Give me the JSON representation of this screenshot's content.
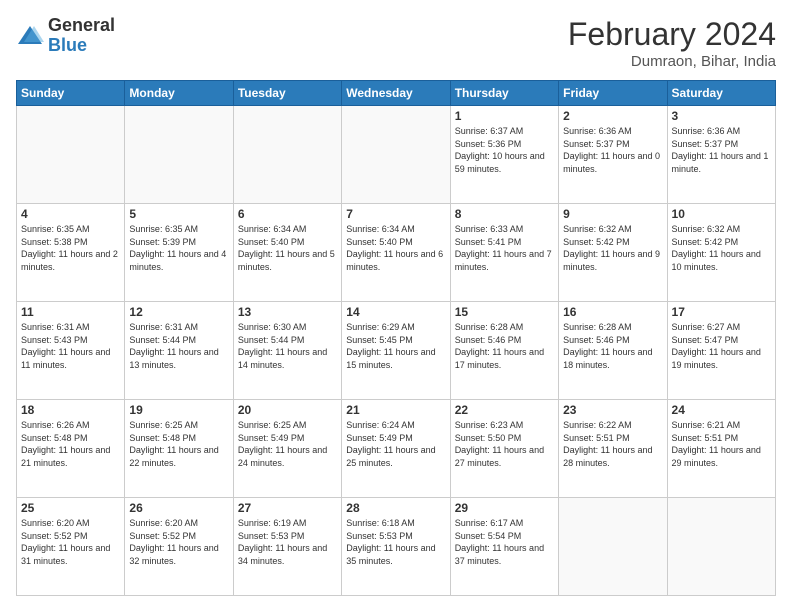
{
  "logo": {
    "general": "General",
    "blue": "Blue"
  },
  "title": {
    "month_year": "February 2024",
    "location": "Dumraon, Bihar, India"
  },
  "days_of_week": [
    "Sunday",
    "Monday",
    "Tuesday",
    "Wednesday",
    "Thursday",
    "Friday",
    "Saturday"
  ],
  "weeks": [
    [
      {
        "day": "",
        "sunrise": "",
        "sunset": "",
        "daylight": ""
      },
      {
        "day": "",
        "sunrise": "",
        "sunset": "",
        "daylight": ""
      },
      {
        "day": "",
        "sunrise": "",
        "sunset": "",
        "daylight": ""
      },
      {
        "day": "",
        "sunrise": "",
        "sunset": "",
        "daylight": ""
      },
      {
        "day": "1",
        "sunrise": "Sunrise: 6:37 AM",
        "sunset": "Sunset: 5:36 PM",
        "daylight": "Daylight: 10 hours and 59 minutes."
      },
      {
        "day": "2",
        "sunrise": "Sunrise: 6:36 AM",
        "sunset": "Sunset: 5:37 PM",
        "daylight": "Daylight: 11 hours and 0 minutes."
      },
      {
        "day": "3",
        "sunrise": "Sunrise: 6:36 AM",
        "sunset": "Sunset: 5:37 PM",
        "daylight": "Daylight: 11 hours and 1 minute."
      }
    ],
    [
      {
        "day": "4",
        "sunrise": "Sunrise: 6:35 AM",
        "sunset": "Sunset: 5:38 PM",
        "daylight": "Daylight: 11 hours and 2 minutes."
      },
      {
        "day": "5",
        "sunrise": "Sunrise: 6:35 AM",
        "sunset": "Sunset: 5:39 PM",
        "daylight": "Daylight: 11 hours and 4 minutes."
      },
      {
        "day": "6",
        "sunrise": "Sunrise: 6:34 AM",
        "sunset": "Sunset: 5:40 PM",
        "daylight": "Daylight: 11 hours and 5 minutes."
      },
      {
        "day": "7",
        "sunrise": "Sunrise: 6:34 AM",
        "sunset": "Sunset: 5:40 PM",
        "daylight": "Daylight: 11 hours and 6 minutes."
      },
      {
        "day": "8",
        "sunrise": "Sunrise: 6:33 AM",
        "sunset": "Sunset: 5:41 PM",
        "daylight": "Daylight: 11 hours and 7 minutes."
      },
      {
        "day": "9",
        "sunrise": "Sunrise: 6:32 AM",
        "sunset": "Sunset: 5:42 PM",
        "daylight": "Daylight: 11 hours and 9 minutes."
      },
      {
        "day": "10",
        "sunrise": "Sunrise: 6:32 AM",
        "sunset": "Sunset: 5:42 PM",
        "daylight": "Daylight: 11 hours and 10 minutes."
      }
    ],
    [
      {
        "day": "11",
        "sunrise": "Sunrise: 6:31 AM",
        "sunset": "Sunset: 5:43 PM",
        "daylight": "Daylight: 11 hours and 11 minutes."
      },
      {
        "day": "12",
        "sunrise": "Sunrise: 6:31 AM",
        "sunset": "Sunset: 5:44 PM",
        "daylight": "Daylight: 11 hours and 13 minutes."
      },
      {
        "day": "13",
        "sunrise": "Sunrise: 6:30 AM",
        "sunset": "Sunset: 5:44 PM",
        "daylight": "Daylight: 11 hours and 14 minutes."
      },
      {
        "day": "14",
        "sunrise": "Sunrise: 6:29 AM",
        "sunset": "Sunset: 5:45 PM",
        "daylight": "Daylight: 11 hours and 15 minutes."
      },
      {
        "day": "15",
        "sunrise": "Sunrise: 6:28 AM",
        "sunset": "Sunset: 5:46 PM",
        "daylight": "Daylight: 11 hours and 17 minutes."
      },
      {
        "day": "16",
        "sunrise": "Sunrise: 6:28 AM",
        "sunset": "Sunset: 5:46 PM",
        "daylight": "Daylight: 11 hours and 18 minutes."
      },
      {
        "day": "17",
        "sunrise": "Sunrise: 6:27 AM",
        "sunset": "Sunset: 5:47 PM",
        "daylight": "Daylight: 11 hours and 19 minutes."
      }
    ],
    [
      {
        "day": "18",
        "sunrise": "Sunrise: 6:26 AM",
        "sunset": "Sunset: 5:48 PM",
        "daylight": "Daylight: 11 hours and 21 minutes."
      },
      {
        "day": "19",
        "sunrise": "Sunrise: 6:25 AM",
        "sunset": "Sunset: 5:48 PM",
        "daylight": "Daylight: 11 hours and 22 minutes."
      },
      {
        "day": "20",
        "sunrise": "Sunrise: 6:25 AM",
        "sunset": "Sunset: 5:49 PM",
        "daylight": "Daylight: 11 hours and 24 minutes."
      },
      {
        "day": "21",
        "sunrise": "Sunrise: 6:24 AM",
        "sunset": "Sunset: 5:49 PM",
        "daylight": "Daylight: 11 hours and 25 minutes."
      },
      {
        "day": "22",
        "sunrise": "Sunrise: 6:23 AM",
        "sunset": "Sunset: 5:50 PM",
        "daylight": "Daylight: 11 hours and 27 minutes."
      },
      {
        "day": "23",
        "sunrise": "Sunrise: 6:22 AM",
        "sunset": "Sunset: 5:51 PM",
        "daylight": "Daylight: 11 hours and 28 minutes."
      },
      {
        "day": "24",
        "sunrise": "Sunrise: 6:21 AM",
        "sunset": "Sunset: 5:51 PM",
        "daylight": "Daylight: 11 hours and 29 minutes."
      }
    ],
    [
      {
        "day": "25",
        "sunrise": "Sunrise: 6:20 AM",
        "sunset": "Sunset: 5:52 PM",
        "daylight": "Daylight: 11 hours and 31 minutes."
      },
      {
        "day": "26",
        "sunrise": "Sunrise: 6:20 AM",
        "sunset": "Sunset: 5:52 PM",
        "daylight": "Daylight: 11 hours and 32 minutes."
      },
      {
        "day": "27",
        "sunrise": "Sunrise: 6:19 AM",
        "sunset": "Sunset: 5:53 PM",
        "daylight": "Daylight: 11 hours and 34 minutes."
      },
      {
        "day": "28",
        "sunrise": "Sunrise: 6:18 AM",
        "sunset": "Sunset: 5:53 PM",
        "daylight": "Daylight: 11 hours and 35 minutes."
      },
      {
        "day": "29",
        "sunrise": "Sunrise: 6:17 AM",
        "sunset": "Sunset: 5:54 PM",
        "daylight": "Daylight: 11 hours and 37 minutes."
      },
      {
        "day": "",
        "sunrise": "",
        "sunset": "",
        "daylight": ""
      },
      {
        "day": "",
        "sunrise": "",
        "sunset": "",
        "daylight": ""
      }
    ]
  ]
}
